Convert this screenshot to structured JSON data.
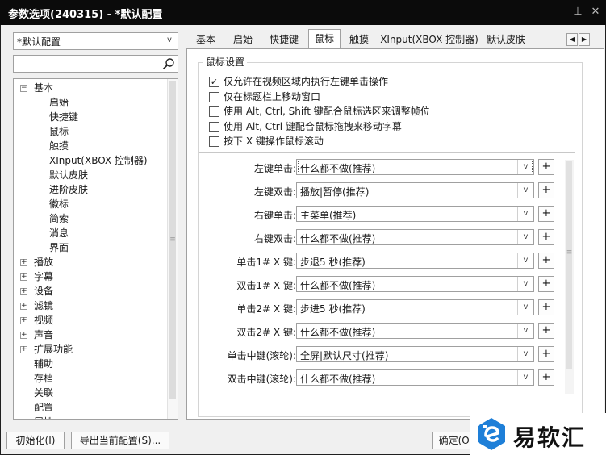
{
  "window": {
    "title": "参数选项(240315) - *默认配置",
    "pin_glyph": "⊥",
    "close_glyph": "✕"
  },
  "profile": {
    "value": "*默认配置"
  },
  "search": {
    "placeholder": ""
  },
  "tree": [
    {
      "label": "基本",
      "expand": "−"
    },
    {
      "label": "启始"
    },
    {
      "label": "快捷键"
    },
    {
      "label": "鼠标"
    },
    {
      "label": "触摸"
    },
    {
      "label": "XInput(XBOX 控制器)"
    },
    {
      "label": "默认皮肤"
    },
    {
      "label": "进阶皮肤"
    },
    {
      "label": "徽标"
    },
    {
      "label": "简索"
    },
    {
      "label": "消息"
    },
    {
      "label": "界面"
    },
    {
      "label": "播放",
      "expand": "+"
    },
    {
      "label": "字幕",
      "expand": "+"
    },
    {
      "label": "设备",
      "expand": "+"
    },
    {
      "label": "滤镜",
      "expand": "+"
    },
    {
      "label": "视频",
      "expand": "+"
    },
    {
      "label": "声音",
      "expand": "+"
    },
    {
      "label": "扩展功能",
      "expand": "+"
    },
    {
      "label": "辅助"
    },
    {
      "label": "存档"
    },
    {
      "label": "关联"
    },
    {
      "label": "配置"
    },
    {
      "label": "属性"
    }
  ],
  "tabs": [
    "基本",
    "启始",
    "快捷键",
    "鼠标",
    "触摸",
    "XInput(XBOX 控制器)",
    "默认皮肤"
  ],
  "tab_scroll": {
    "left": "◀",
    "right": "▶"
  },
  "group": {
    "title": "鼠标设置",
    "checkboxes": [
      {
        "label": "仅允许在视频区域内执行左键单击操作",
        "checked": true
      },
      {
        "label": "仅在标题栏上移动窗口",
        "checked": false
      },
      {
        "label": "使用 Alt, Ctrl, Shift 键配合鼠标选区来调整帧位",
        "checked": false
      },
      {
        "label": "使用 Alt, Ctrl 键配合鼠标拖拽来移动字幕",
        "checked": false
      },
      {
        "label": "按下 X 键操作鼠标滚动",
        "checked": false
      }
    ]
  },
  "settings": [
    {
      "label": "左键单击:",
      "value": "什么都不做(推荐)"
    },
    {
      "label": "左键双击:",
      "value": "播放|暂停(推荐)"
    },
    {
      "label": "右键单击:",
      "value": "主菜单(推荐)"
    },
    {
      "label": "右键双击:",
      "value": "什么都不做(推荐)"
    },
    {
      "label": "单击1# X 键:",
      "value": "步退5 秒(推荐)"
    },
    {
      "label": "双击1# X 键:",
      "value": "什么都不做(推荐)"
    },
    {
      "label": "单击2# X 键:",
      "value": "步进5 秒(推荐)"
    },
    {
      "label": "双击2# X 键:",
      "value": "什么都不做(推荐)"
    },
    {
      "label": "单击中键(滚轮):",
      "value": "全屏|默认尺寸(推荐)"
    },
    {
      "label": "双击中键(滚轮):",
      "value": "什么都不做(推荐)"
    }
  ],
  "glyphs": {
    "dropdown": "v",
    "plus": "+",
    "grip": "≡"
  },
  "buttons": {
    "reset": "初始化(I)",
    "export": "导出当前配置(S)...",
    "ok": "确定(O)"
  },
  "watermark": {
    "text": "易软汇"
  },
  "colors": {
    "titlebar": "#0b0b0b",
    "accent": "#1e7fd8"
  }
}
